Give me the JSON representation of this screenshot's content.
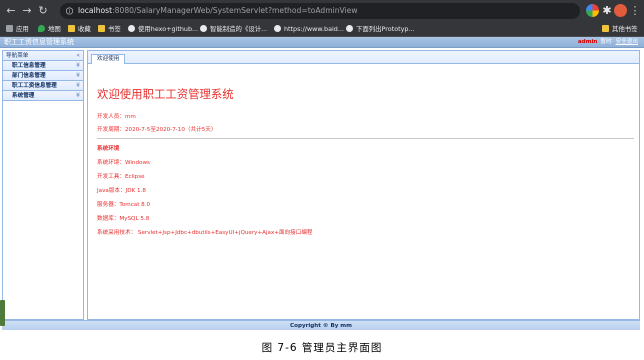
{
  "browser": {
    "url_host": "localhost",
    "url_rest": ":8080/SalaryManagerWeb/SystemServlet?method=toAdminView",
    "bookmarks": [
      {
        "label": "应用",
        "icon": "apps-icon"
      },
      {
        "label": "地图",
        "icon": "map-pin-icon"
      },
      {
        "label": "收藏",
        "icon": "folder-icon"
      },
      {
        "label": "书签",
        "icon": "folder-icon"
      },
      {
        "label": "使用hexo+github...",
        "icon": "globe-icon"
      },
      {
        "label": "智能制造的《设计...",
        "icon": "globe-icon"
      },
      {
        "label": "https://www.baid...",
        "icon": "globe-icon"
      },
      {
        "label": "下面列出Prototyp...",
        "icon": "globe-icon"
      }
    ],
    "other_bookmarks": "其他书签"
  },
  "app": {
    "title": "职工工资信息管理系统",
    "user": "admin",
    "user_link_1": "暂时",
    "user_link_2": "安全退出"
  },
  "sidebar": {
    "title": "导航菜单",
    "items": [
      {
        "label": "职工信息管理"
      },
      {
        "label": "部门信息管理"
      },
      {
        "label": "职工工资信息管理"
      },
      {
        "label": "系统管理"
      }
    ]
  },
  "tabs": [
    {
      "label": "欢迎使用",
      "active": true
    }
  ],
  "welcome": {
    "heading": "欢迎使用职工工资管理系统",
    "developer": "开发人员：mm",
    "period": "开发周期：2020-7-5至2020-7-10（共计5天）",
    "env_title": "系统环境",
    "os": "系统环境：Windows",
    "tool": "开发工具：Eclipse",
    "java": "Java版本：JDK 1.8",
    "server": "服务器：Tomcat 8.0",
    "db": "数据库：MySQL 5.8",
    "tech": "系统采用技术： Servlet+Jsp+Jdbc+dbutils+EasyUI+jQuery+Ajax+面向接口编程"
  },
  "footer": {
    "text": "Copyright © By mm"
  },
  "caption": "图 7-6  管理员主界面图",
  "colors": {
    "accent_red": "#e8302f",
    "header_blue": "#8fb0d9",
    "border_blue": "#95b8e7"
  }
}
